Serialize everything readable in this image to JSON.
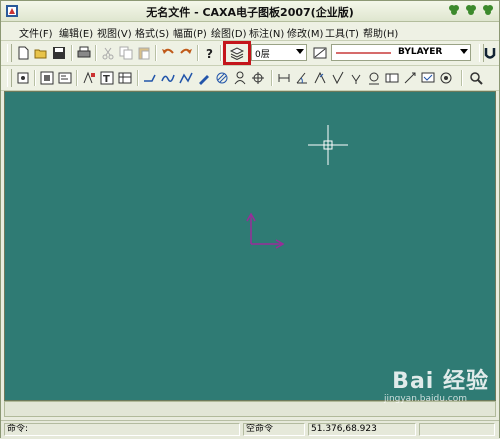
{
  "window": {
    "title": "无名文件 - CAXA电子图板2007(企业版)"
  },
  "menus": [
    {
      "label": "文件(F)"
    },
    {
      "label": "编辑(E)"
    },
    {
      "label": "视图(V)"
    },
    {
      "label": "格式(S)"
    },
    {
      "label": "幅面(P)"
    },
    {
      "label": "绘图(D)"
    },
    {
      "label": "标注(N)"
    },
    {
      "label": "修改(M)"
    },
    {
      "label": "工具(T)"
    },
    {
      "label": "帮助(H)"
    }
  ],
  "toolbar": {
    "layer_value": "0层",
    "linetype_value": "BYLAYER",
    "colors": {
      "highlight": "#c4151b",
      "linetype_line": "#c83a3a"
    }
  },
  "canvas": {
    "background": "#2f7b74",
    "crosshair_color": "#ffffff",
    "ucs_color": "#9a2c9a"
  },
  "status": {
    "command_label": "命令:",
    "command_state": "空命令",
    "coordinates": "51.376,68.923"
  },
  "watermark": {
    "brand": "Bai 经验",
    "url": "jingyan.baidu.com"
  }
}
